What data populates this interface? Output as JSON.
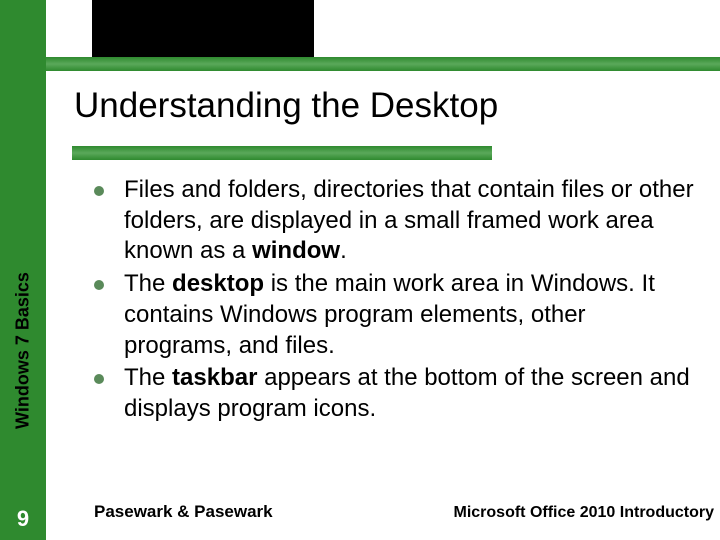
{
  "sidebar": {
    "label": "Windows 7 Basics",
    "page_number": "9"
  },
  "title": "Understanding the Desktop",
  "bullets": [
    {
      "pre": "Files and folders, directories that contain files or other folders, are displayed in a small framed work area known as a ",
      "bold": "window",
      "post": "."
    },
    {
      "pre": "The ",
      "bold": "desktop",
      "post": " is the main work area in Windows. It contains Windows program elements, other programs, and files."
    },
    {
      "pre": "The ",
      "bold": "taskbar",
      "post": " appears at the bottom of the screen and displays program icons."
    }
  ],
  "footer": {
    "left": "Pasewark & Pasewark",
    "right": "Microsoft Office 2010 Introductory"
  }
}
